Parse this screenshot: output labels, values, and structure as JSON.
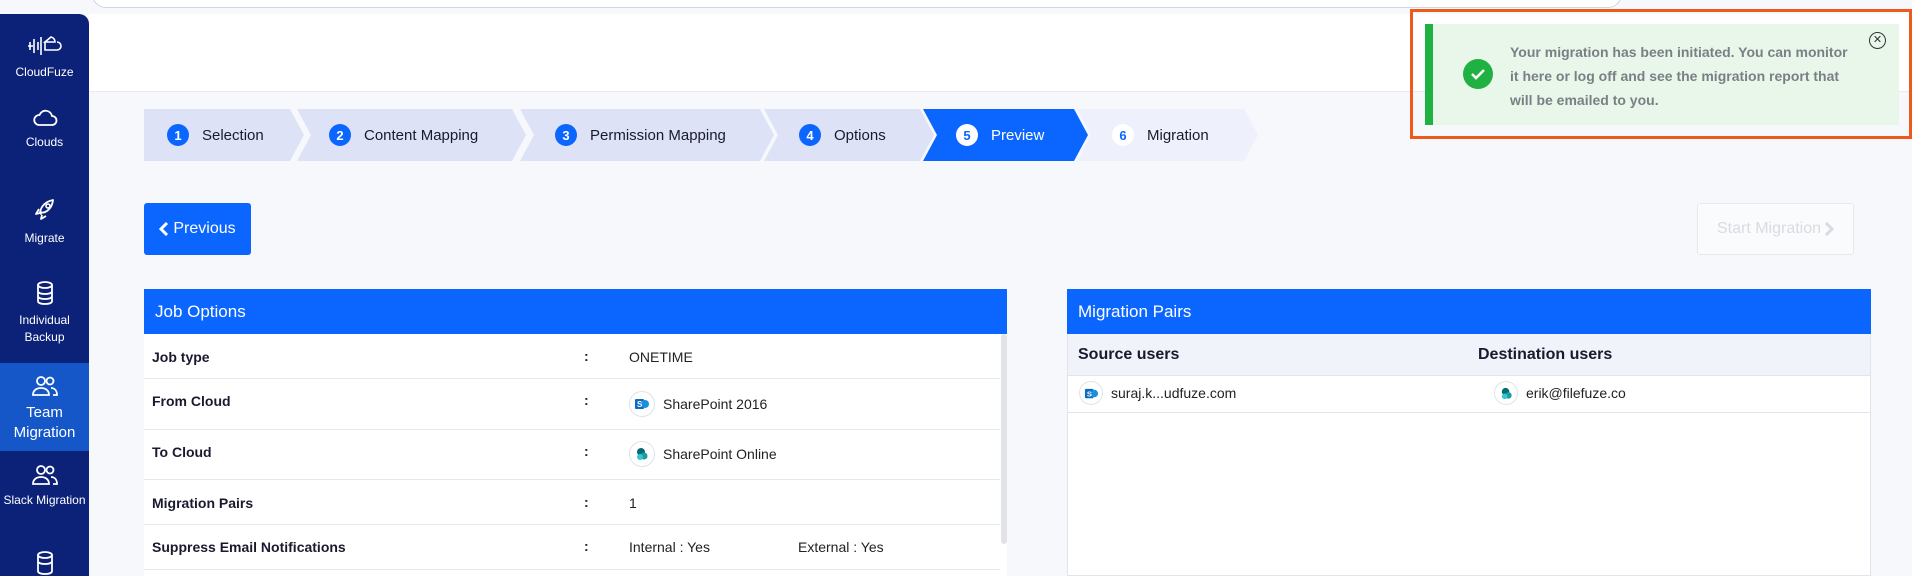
{
  "sidebar": {
    "items": [
      {
        "label": "CloudFuze"
      },
      {
        "label": "Clouds"
      },
      {
        "label": "Migrate"
      },
      {
        "label": "Individual Backup"
      },
      {
        "label": "Team Migration"
      },
      {
        "label": "Slack Migration"
      }
    ]
  },
  "stepper": {
    "steps": [
      {
        "num": "1",
        "label": "Selection"
      },
      {
        "num": "2",
        "label": "Content Mapping"
      },
      {
        "num": "3",
        "label": "Permission Mapping"
      },
      {
        "num": "4",
        "label": "Options"
      },
      {
        "num": "5",
        "label": "Preview"
      },
      {
        "num": "6",
        "label": "Migration"
      }
    ]
  },
  "buttons": {
    "previous": "Previous",
    "start": "Start Migration"
  },
  "job_options": {
    "title": "Job Options",
    "separator": ":",
    "rows": [
      {
        "key": "Job type",
        "value": "ONETIME"
      },
      {
        "key": "From Cloud",
        "value": "SharePoint 2016"
      },
      {
        "key": "To Cloud",
        "value": "SharePoint Online"
      },
      {
        "key": "Migration Pairs",
        "value": "1"
      },
      {
        "key": "Suppress Email Notifications",
        "internal": "Internal : Yes",
        "external": "External : Yes"
      }
    ]
  },
  "migration_pairs": {
    "title": "Migration Pairs",
    "col_source": "Source users",
    "col_destination": "Destination users",
    "rows": [
      {
        "source": "suraj.k...udfuze.com",
        "destination": "erik@filefuze.co"
      }
    ]
  },
  "toast": {
    "message": "Your migration has been initiated. You can monitor it here or log off and see the migration report that will be emailed to you.",
    "close": "✕"
  },
  "colors": {
    "sidebar": "#0c2278",
    "primary": "#0b66ff",
    "success": "#1fb141",
    "highlight": "#ee5a1b"
  }
}
